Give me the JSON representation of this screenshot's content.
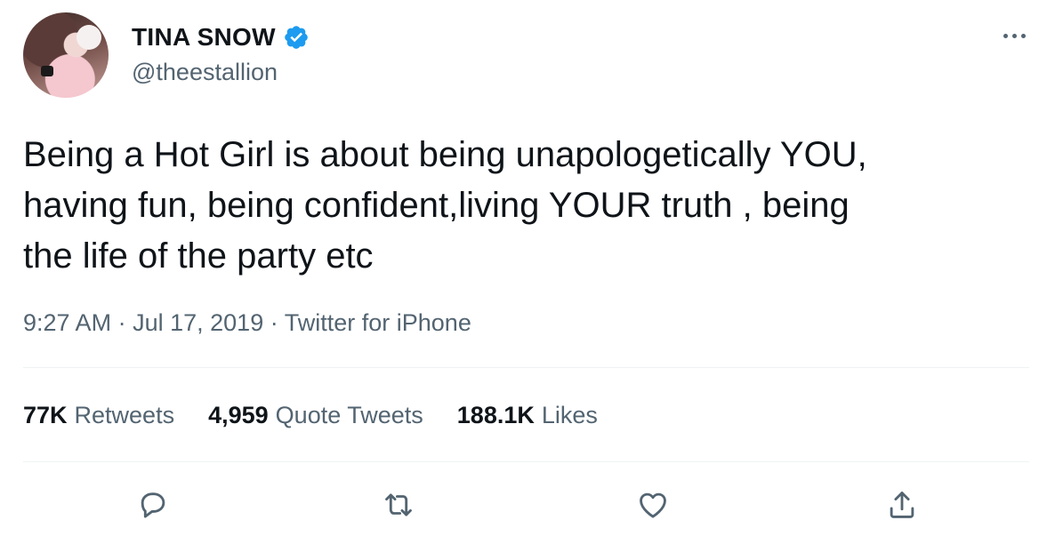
{
  "author": {
    "display_name": "TINA SNOW",
    "handle": "@theestallion",
    "verified": true
  },
  "tweet": {
    "text": "Being a Hot Girl is about being unapologetically YOU,\nhaving fun, being confident,living YOUR truth , being\nthe life of the party etc",
    "time": "9:27 AM",
    "separator": "·",
    "date": "Jul 17, 2019",
    "source": "Twitter for iPhone"
  },
  "stats": {
    "retweets": {
      "count": "77K",
      "label": "Retweets"
    },
    "quotes": {
      "count": "4,959",
      "label": "Quote Tweets"
    },
    "likes": {
      "count": "188.1K",
      "label": "Likes"
    }
  },
  "icons": {
    "more": "more-icon",
    "reply": "reply-icon",
    "retweet": "retweet-icon",
    "like": "heart-icon",
    "share": "share-icon",
    "verified": "verified-badge-icon"
  },
  "colors": {
    "text": "#0f1419",
    "secondary": "#536471",
    "verified": "#1d9bf0",
    "divider": "#eff3f4"
  }
}
